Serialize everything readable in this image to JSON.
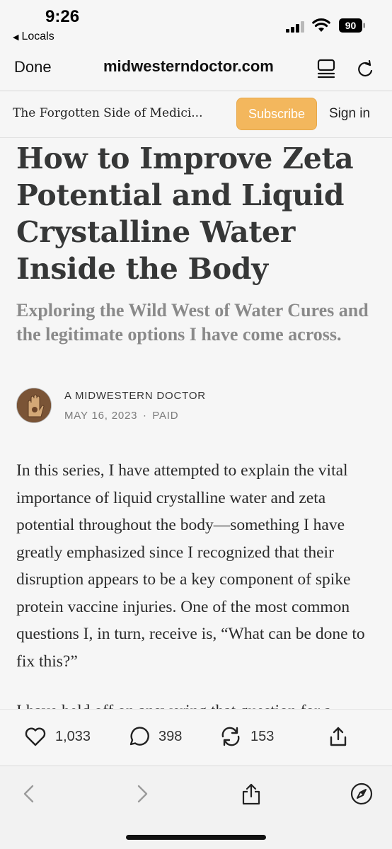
{
  "status_bar": {
    "time": "9:26",
    "back_app": "Locals",
    "battery": "90"
  },
  "nav": {
    "done_label": "Done",
    "url": "midwesterndoctor.com"
  },
  "site_header": {
    "publication_name": "The Forgotten Side of Medici...",
    "subscribe_label": "Subscribe",
    "signin_label": "Sign in"
  },
  "article": {
    "title": "How to Improve Zeta Potential and Liquid Crystalline Water Inside the Body",
    "subtitle": "Exploring the Wild West of Water Cures and the legitimate options I have come across.",
    "author": "A MIDWESTERN DOCTOR",
    "date": "MAY 16, 2023",
    "separator": "∙",
    "access": "PAID",
    "paragraph_1": "In this series, I have attempted to explain the vital importance of liquid crystalline water and zeta potential throughout the body—something I have greatly emphasized since I recognized that their disruption appears to be a key component of spike protein vaccine injuries. One of the most common questions I, in turn, receive is, “What can be done to fix this?”",
    "paragraph_2_partial": "I have held off on answering that question for a"
  },
  "engagement": {
    "likes": "1,033",
    "comments": "398",
    "restacks": "153"
  },
  "icons": {
    "like": "heart-icon",
    "comment": "comment-bubble-icon",
    "restack": "restack-arrows-icon",
    "share": "share-icon",
    "back": "chevron-left-icon",
    "forward": "chevron-right-icon",
    "compass": "compass-icon"
  },
  "colors": {
    "subscribe_bg": "#f3b75d",
    "title_text": "#363737",
    "subtitle_text": "#8a8a8a"
  }
}
